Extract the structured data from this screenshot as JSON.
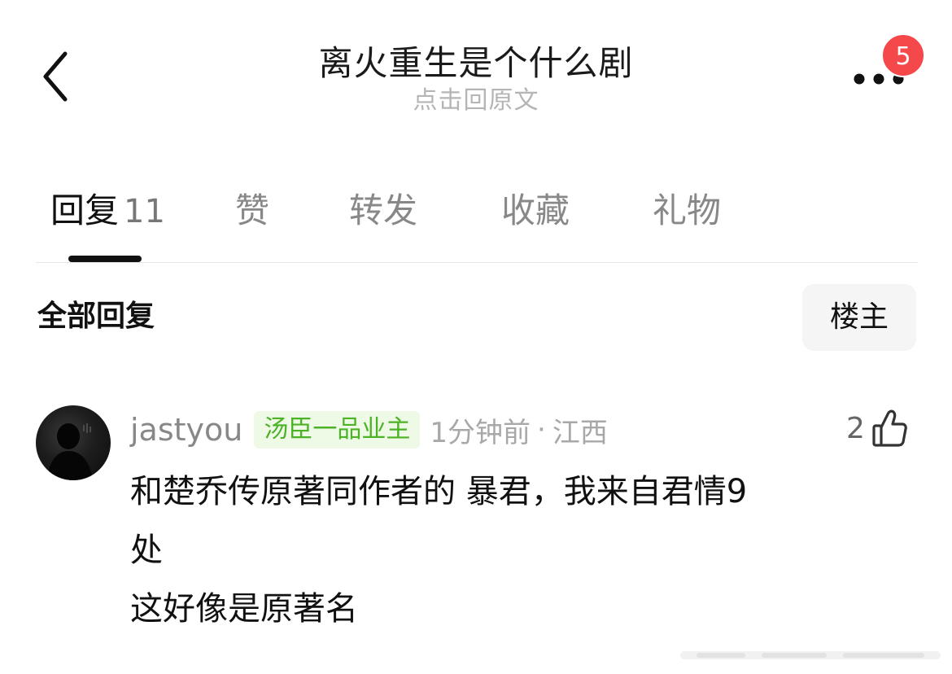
{
  "header": {
    "title": "离火重生是个什么剧",
    "subtitle": "点击回原文",
    "back_icon": "chevron-left-icon",
    "more_icon": "more-dots-icon",
    "notification_badge": "5",
    "badge_color": "#f5484a"
  },
  "tabs": [
    {
      "label": "回复",
      "count": "11",
      "active": true
    },
    {
      "label": "赞",
      "count": "",
      "active": false
    },
    {
      "label": "转发",
      "count": "",
      "active": false
    },
    {
      "label": "收藏",
      "count": "",
      "active": false
    },
    {
      "label": "礼物",
      "count": "",
      "active": false
    }
  ],
  "section": {
    "title": "全部回复",
    "op_filter_label": "楼主"
  },
  "comments": [
    {
      "username": "jastyou",
      "badge": "汤臣一品业主",
      "badge_color": "#4cb226",
      "time": "1分钟前",
      "separator": "·",
      "location": "江西",
      "like_count": "2",
      "like_icon": "thumbs-up-icon",
      "lines": [
        "和楚乔传原著同作者的  暴君，我来自君情9",
        "处",
        "这好像是原著名"
      ]
    }
  ]
}
